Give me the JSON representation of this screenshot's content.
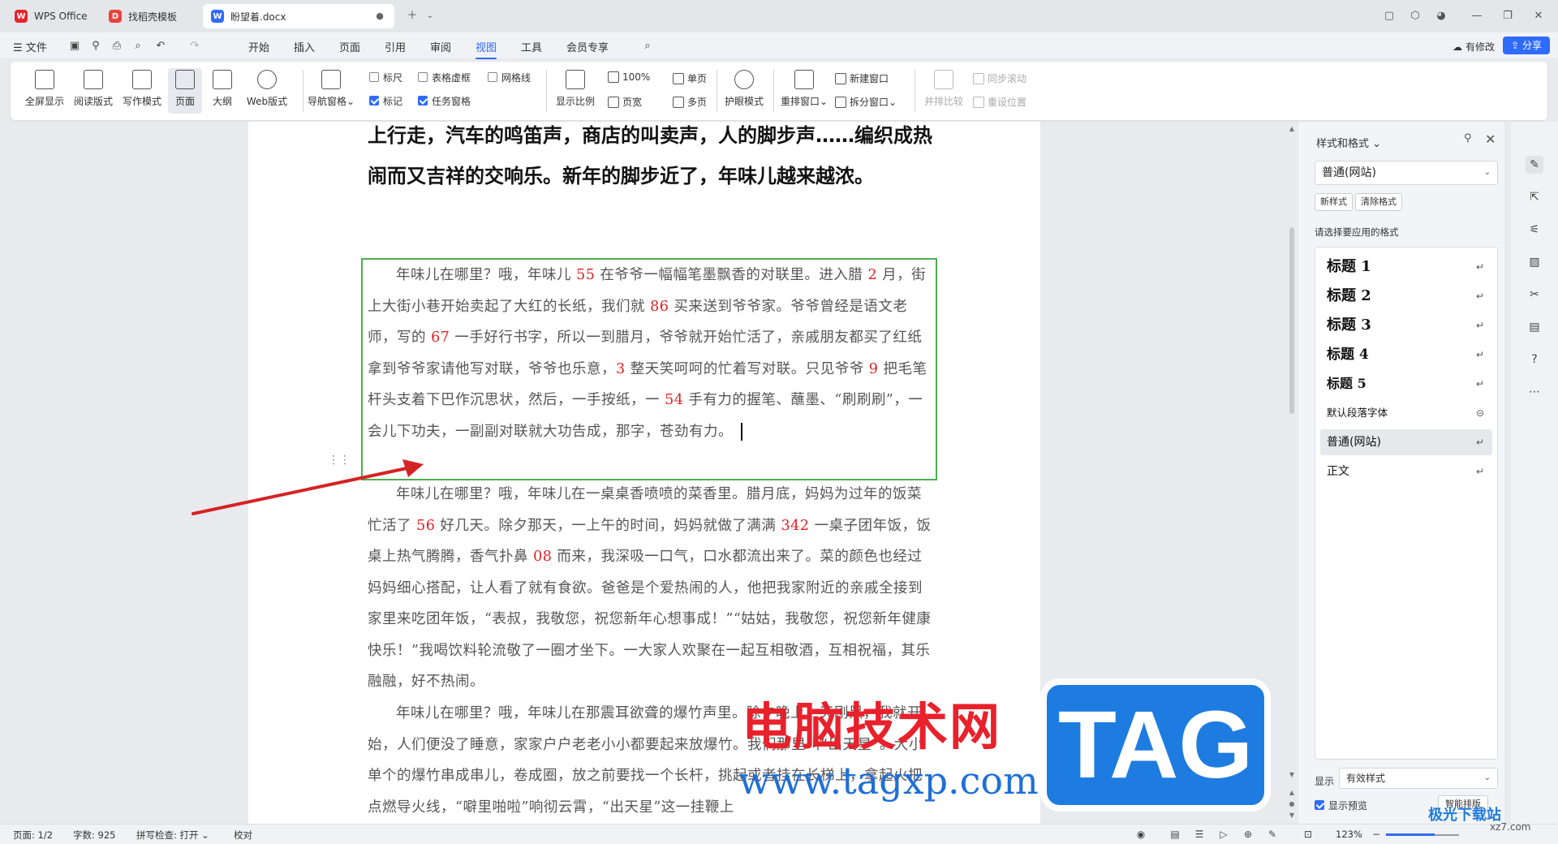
{
  "tabs": [
    {
      "label": "WPS Office",
      "logo": "W"
    },
    {
      "label": "找稻壳模板",
      "logo": "D"
    },
    {
      "label": "盼望着.docx",
      "logo": "W"
    }
  ],
  "menu": {
    "file": "文件",
    "items": [
      "开始",
      "插入",
      "页面",
      "引用",
      "审阅",
      "视图",
      "工具",
      "会员专享"
    ],
    "active": "视图",
    "modified": "有修改",
    "share": "分享"
  },
  "ribbon": {
    "big_buttons": [
      "全屏显示",
      "阅读版式",
      "写作模式",
      "页面",
      "大纲",
      "Web版式"
    ],
    "nav_pane": "导航窗格",
    "checks": [
      {
        "label": "标尺",
        "checked": false
      },
      {
        "label": "表格虚框",
        "checked": false
      },
      {
        "label": "网格线",
        "checked": false
      },
      {
        "label": "标记",
        "checked": true
      },
      {
        "label": "任务窗格",
        "checked": true
      }
    ],
    "zoom_ratio": "显示比例",
    "zoom100": "100%",
    "single_page": "单页",
    "page_width": "页宽",
    "multi_page": "多页",
    "eye_mode": "护眼模式",
    "rearrange": "重排窗口",
    "new_window": "新建窗口",
    "split_window": "拆分窗口",
    "side_by_side": "并排比较",
    "sync_scroll": "同步滚动",
    "reset_pos": "重设位置"
  },
  "document": {
    "heading": "上行走，汽车的鸣笛声，商店的叫卖声，人的脚步声……编织成热闹而又吉祥的交响乐。新年的脚步近了，年味儿越来越浓。",
    "p1": [
      {
        "t": "年味儿在哪里？哦，年味儿 "
      },
      {
        "n": "55"
      },
      {
        "t": " 在爷爷一幅幅笔墨飘香的对联里。进入腊 "
      },
      {
        "n": "2"
      },
      {
        "t": " 月，街上大街小巷开始卖起了大红的长纸，我们就 "
      },
      {
        "n": "86"
      },
      {
        "t": " 买来送到爷爷家。爷爷曾经是语文老师，写的 "
      },
      {
        "n": "67"
      },
      {
        "t": " 一手好行书字，所以一到腊月，爷爷就开始忙活了，亲戚朋友都买了红纸拿到爷爷家请他写对联，爷爷也乐意，"
      },
      {
        "n": "3"
      },
      {
        "t": " 整天笑呵呵的忙着写对联。只见爷爷 "
      },
      {
        "n": "9"
      },
      {
        "t": " 把毛笔杆头支着下巴作沉思状，然后，一手按纸，一 "
      },
      {
        "n": "54"
      },
      {
        "t": " 手有力的握笔、蘸墨、“刷刷刷”，一会儿下功夫，一副副对联就大功告成，那字，苍劲有力。"
      }
    ],
    "p2": [
      {
        "t": "年味儿在哪里？哦，年味儿在一桌桌香喷喷的菜香里。腊月底，妈妈为过年的饭菜忙活了 "
      },
      {
        "n": "56"
      },
      {
        "t": " 好几天。除夕那天，一上午的时间，妈妈就做了满满 "
      },
      {
        "n": "342"
      },
      {
        "t": " 一桌子团年饭，饭桌上热气腾腾，香气扑鼻 "
      },
      {
        "n": "08"
      },
      {
        "t": " 而来，我深吸一口气，口水都流出来了。菜的颜色也经过妈妈细心搭配，让人看了就有食欲。爸爸是个爱热闹的人，他把我家附近的亲戚全接到家里来吃团年饭，“表叔，我敬您，祝您新年心想事成！”“姑姑，我敬您，祝您新年健康快乐！”我喝饮料轮流敬了一圈才坐下。一大家人欢聚在一起互相敬酒，互相祝福，其乐融融，好不热闹。"
      }
    ],
    "p3": [
      {
        "t": "年味儿在哪里？哦，年味儿在那震耳欲聋的爆竹声里。除夕晚上，天刚黑，我就开始，人们便没了睡意，家家户户老老小小都要起来放爆竹。我们那里叫“出天星”。大小单个的爆竹串成串儿，卷成圈，放之前要找一个长杆，挑起或者挂在长梯上，拿起火把点燃导火线，“噼里啪啦”响彻云霄，“出天星”这一挂鞭上"
      }
    ]
  },
  "watermark": {
    "title": "电脑技术网",
    "url": "www.tagxp.com",
    "tag": "TAG",
    "corner": "极光下载站",
    "corner_url": "xz7.com"
  },
  "panel": {
    "title": "样式和格式",
    "current_style": "普通(网站)",
    "new_style": "新样式",
    "clear_format": "清除格式",
    "hint": "请选择要应用的格式",
    "styles": [
      {
        "label": "标题  1",
        "heading": true
      },
      {
        "label": "标题  2",
        "heading": true
      },
      {
        "label": "标题  3",
        "heading": true
      },
      {
        "label": "标题 4",
        "heading": true
      },
      {
        "label": "标题 5",
        "heading": true
      },
      {
        "label": "默认段落字体",
        "heading": false
      },
      {
        "label": "普通(网站)",
        "heading": false,
        "selected": true
      },
      {
        "label": "正文",
        "heading": false
      }
    ],
    "show_label": "显示",
    "show_value": "有效样式",
    "preview": "显示预览",
    "smart": "智能排版"
  },
  "status": {
    "page": "页面: 1/2",
    "words": "字数: 925",
    "spell": "拼写检查: 打开",
    "proof": "校对",
    "zoom": "123%"
  },
  "colors": {
    "accent": "#2f6bff",
    "selection_border": "#4caf50",
    "number_red": "#e02020"
  }
}
